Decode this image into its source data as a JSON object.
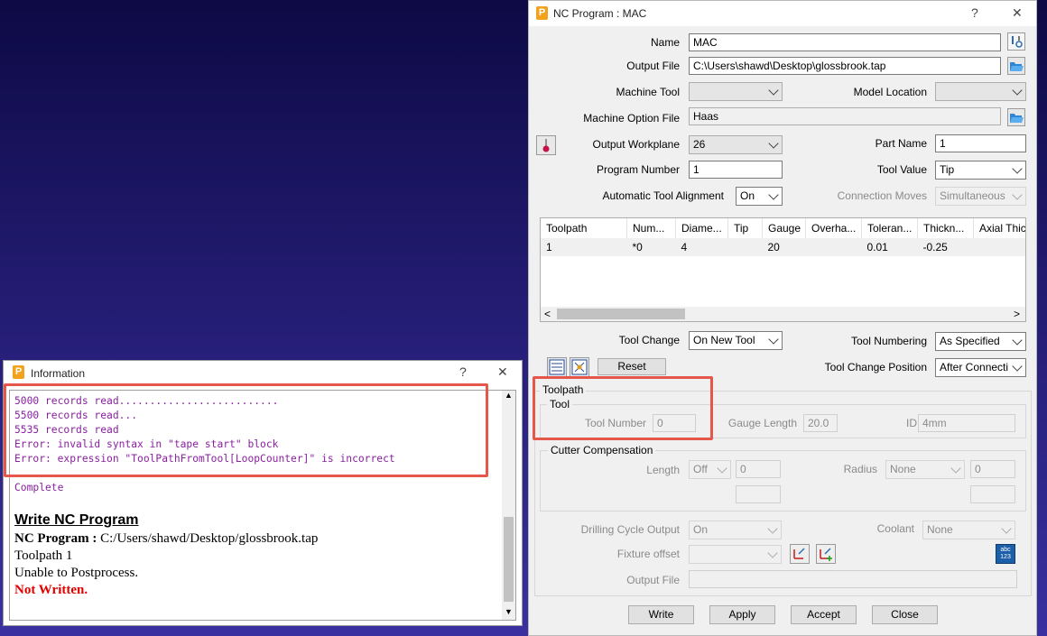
{
  "nc_dialog": {
    "title": "NC Program : MAC",
    "help": "?",
    "close": "✕",
    "name_label": "Name",
    "name_value": "MAC",
    "output_file_label": "Output File",
    "output_file_value": "C:\\Users\\shawd\\Desktop\\glossbrook.tap",
    "machine_tool_label": "Machine Tool",
    "machine_tool_value": "",
    "model_location_label": "Model Location",
    "model_location_value": "",
    "machine_option_label": "Machine Option File",
    "machine_option_value": "Haas",
    "output_workplane_label": "Output Workplane",
    "output_workplane_value": "26",
    "part_name_label": "Part Name",
    "part_name_value": "1",
    "program_number_label": "Program Number",
    "program_number_value": "1",
    "tool_value_label": "Tool Value",
    "tool_value_value": "Tip",
    "auto_align_label": "Automatic Tool Alignment",
    "auto_align_value": "On",
    "connection_moves_label": "Connection Moves",
    "connection_moves_value": "Simultaneous",
    "table": {
      "headers": [
        "Toolpath",
        "Num...",
        "Diame...",
        "Tip",
        "Gauge",
        "Overha...",
        "Toleran...",
        "Thickn...",
        "Axial Thick"
      ],
      "rows": [
        [
          "1",
          "*0",
          "4",
          "",
          "20",
          "",
          "0.01",
          "-0.25",
          ""
        ]
      ]
    },
    "tool_change_label": "Tool Change",
    "tool_change_value": "On New Tool",
    "tool_numbering_label": "Tool Numbering",
    "tool_numbering_value": "As Specified",
    "reset_label": "Reset",
    "tool_change_position_label": "Tool Change Position",
    "tool_change_position_value": "After Connecti",
    "toolpath_group": "Toolpath",
    "tool_group": "Tool",
    "tool_number_label": "Tool Number",
    "tool_number_value": "0",
    "gauge_length_label": "Gauge Length",
    "gauge_length_value": "20.0",
    "id_label": "ID",
    "id_value": "4mm",
    "cutter_comp_group": "Cutter Compensation",
    "length_label": "Length",
    "length_value": "Off",
    "length_num": "0",
    "radius_label": "Radius",
    "radius_value": "None",
    "radius_num": "0",
    "drilling_label": "Drilling Cycle Output",
    "drilling_value": "On",
    "coolant_label": "Coolant",
    "coolant_value": "None",
    "fixture_label": "Fixture offset",
    "fixture_value": "",
    "output_file2_label": "Output File",
    "output_file2_value": "",
    "abc_icon_text": "abc\n123",
    "buttons": {
      "write": "Write",
      "apply": "Apply",
      "accept": "Accept",
      "close": "Close"
    }
  },
  "info_dialog": {
    "title": "Information",
    "help": "?",
    "close": "✕",
    "log_lines": [
      "5000 records read..........................",
      "5500 records read...",
      "5535 records read",
      "Error: invalid syntax in \"tape start\" block",
      "Error: expression \"ToolPathFromTool[LoopCounter]\" is incorrect"
    ],
    "complete": "Complete",
    "heading": "Write NC Program",
    "nc_program_label": "NC Program :",
    "nc_program_path": "C:/Users/shawd/Desktop/glossbrook.tap",
    "toolpath_line": "Toolpath 1",
    "unable_line": "Unable to Postprocess.",
    "not_written": "Not Written."
  },
  "colors": {
    "accent_red": "#e4574a",
    "console_purple": "#8a1fa0",
    "error_red": "#e00000",
    "logo_orange": "#f2a21b"
  }
}
